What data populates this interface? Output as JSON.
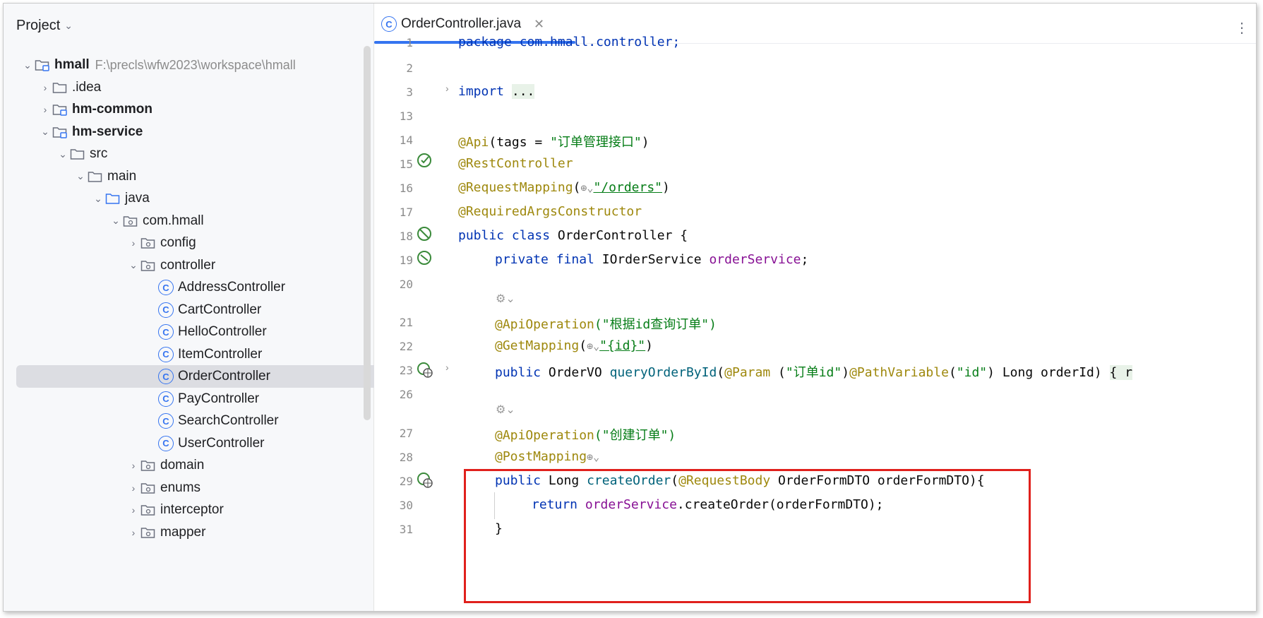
{
  "project": {
    "title": "Project",
    "tree": [
      {
        "label": "hmall",
        "path": "F:\\precls\\wfw2023\\workspace\\hmall",
        "expanded": true,
        "type": "module",
        "bold": true
      },
      {
        "label": ".idea",
        "expanded": false,
        "type": "folder"
      },
      {
        "label": "hm-common",
        "expanded": false,
        "type": "module",
        "bold": true
      },
      {
        "label": "hm-service",
        "expanded": true,
        "type": "module",
        "bold": true
      },
      {
        "label": "src",
        "expanded": true,
        "type": "folder"
      },
      {
        "label": "main",
        "expanded": true,
        "type": "folder"
      },
      {
        "label": "java",
        "expanded": true,
        "type": "source-folder"
      },
      {
        "label": "com.hmall",
        "expanded": true,
        "type": "package"
      },
      {
        "label": "config",
        "expanded": false,
        "type": "package"
      },
      {
        "label": "controller",
        "expanded": true,
        "type": "package"
      },
      {
        "label": "AddressController",
        "type": "class"
      },
      {
        "label": "CartController",
        "type": "class"
      },
      {
        "label": "HelloController",
        "type": "class"
      },
      {
        "label": "ItemController",
        "type": "class"
      },
      {
        "label": "OrderController",
        "type": "class",
        "selected": true
      },
      {
        "label": "PayController",
        "type": "class"
      },
      {
        "label": "SearchController",
        "type": "class"
      },
      {
        "label": "UserController",
        "type": "class"
      },
      {
        "label": "domain",
        "expanded": false,
        "type": "package"
      },
      {
        "label": "enums",
        "expanded": false,
        "type": "package"
      },
      {
        "label": "interceptor",
        "expanded": false,
        "type": "package"
      },
      {
        "label": "mapper",
        "expanded": false,
        "type": "package"
      }
    ]
  },
  "editor": {
    "tab": {
      "label": "OrderController.java",
      "icon": "class-icon"
    },
    "lines": {
      "l1": "package com.hmall.controller;",
      "l3_kw": "import",
      "l3_fold": "...",
      "l14_ann": "@Api",
      "l14_a": "(tags = ",
      "l14_str": "\"订单管理接口\"",
      "l14_b": ")",
      "l15": "@RestController",
      "l16_ann": "@RequestMapping",
      "l16_a": "(",
      "l16_str": "\"/orders\"",
      "l16_b": ")",
      "l17": "@RequiredArgsConstructor",
      "l18_kw": "public class",
      "l18_rest": " OrderController {",
      "l19_kw": "private final",
      "l19_type": " IOrderService ",
      "l19_fld": "orderService",
      "l19_end": ";",
      "l21_ann": "@ApiOperation",
      "l21_str": "(\"根据id查询订单\")",
      "l22_ann": "@GetMapping",
      "l22_a": "(",
      "l22_str": "\"{id}\"",
      "l22_b": ")",
      "l23_kw": "public",
      "l23_type": " OrderVO ",
      "l23_mth": "queryOrderById",
      "l23_a": "(",
      "l23_ann1": "@Param",
      "l23_b": " (",
      "l23_str1": "\"订单id\"",
      "l23_c": ")",
      "l23_ann2": "@PathVariable",
      "l23_d": "(",
      "l23_str2": "\"id\"",
      "l23_e": ") Long orderId) ",
      "l23_fold": "{ r",
      "l27_ann": "@ApiOperation",
      "l27_str": "(\"创建订单\")",
      "l28_ann": "@PostMapping",
      "l29_kw": "public",
      "l29_type": " Long ",
      "l29_mth": "createOrder",
      "l29_a": "(",
      "l29_ann": "@RequestBody",
      "l29_rest": " OrderFormDTO orderFormDTO){",
      "l30_kw": "return",
      "l30_fld": " orderService",
      "l30_rest": ".createOrder(orderFormDTO);",
      "l31": "}"
    },
    "line_numbers": [
      "1",
      "2",
      "3",
      "13",
      "14",
      "15",
      "16",
      "17",
      "18",
      "19",
      "20",
      "21",
      "22",
      "23",
      "26",
      "27",
      "28",
      "29",
      "30",
      "31"
    ]
  },
  "colors": {
    "accent": "#3574f0",
    "highlight": "#e0201c",
    "keyword": "#0033b3",
    "annotation": "#9e880d",
    "string": "#067d17",
    "field": "#871094",
    "method": "#00627a"
  }
}
